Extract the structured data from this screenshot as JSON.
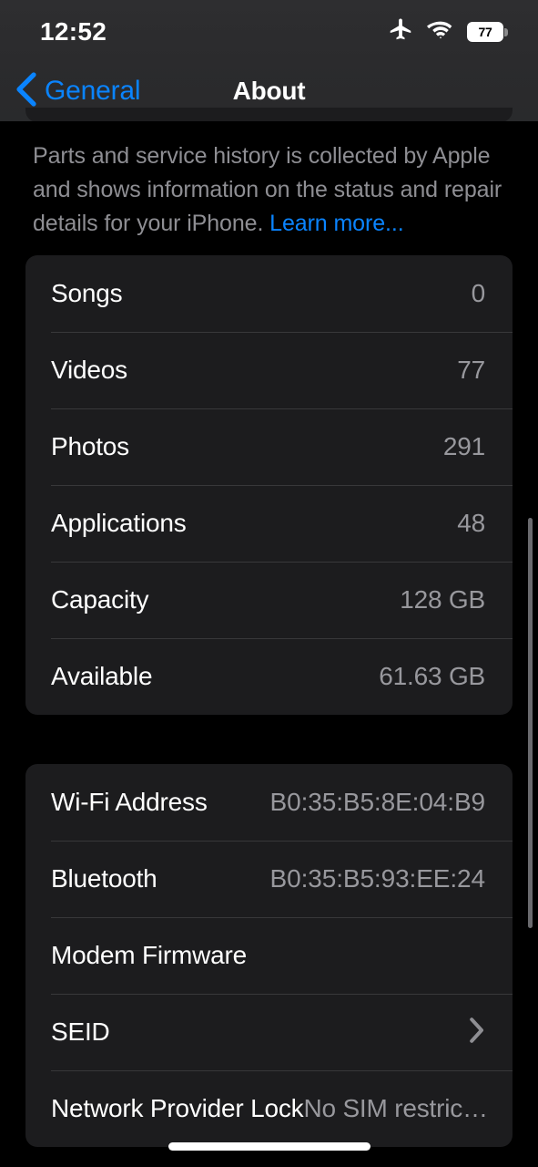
{
  "status_bar": {
    "time": "12:52",
    "battery_percent": "77",
    "icons": [
      "airplane-mode-icon",
      "wifi-icon",
      "battery-icon"
    ]
  },
  "nav": {
    "back_label": "General",
    "title": "About"
  },
  "footer_note": {
    "text": "Parts and service history is collected by Apple and shows information on the status and repair details for your iPhone. ",
    "link_label": "Learn more..."
  },
  "groups": [
    {
      "id": "storage",
      "rows": [
        {
          "label": "Songs",
          "value": "0",
          "chevron": false
        },
        {
          "label": "Videos",
          "value": "77",
          "chevron": false
        },
        {
          "label": "Photos",
          "value": "291",
          "chevron": false
        },
        {
          "label": "Applications",
          "value": "48",
          "chevron": false
        },
        {
          "label": "Capacity",
          "value": "128 GB",
          "chevron": false
        },
        {
          "label": "Available",
          "value": "61.63 GB",
          "chevron": false
        }
      ]
    },
    {
      "id": "hardware",
      "rows": [
        {
          "label": "Wi-Fi Address",
          "value": "B0:35:B5:8E:04:B9",
          "chevron": false
        },
        {
          "label": "Bluetooth",
          "value": "B0:35:B5:93:EE:24",
          "chevron": false
        },
        {
          "label": "Modem Firmware",
          "value": "",
          "chevron": false
        },
        {
          "label": "SEID",
          "value": "",
          "chevron": true
        },
        {
          "label": "Network Provider Lock",
          "value": "No SIM restric…",
          "chevron": false
        }
      ]
    }
  ],
  "colors": {
    "accent_blue": "#0a84ff",
    "card_background": "#1c1c1e",
    "page_background": "#000000",
    "separator": "#38383a",
    "value_gray": "#98989d",
    "note_gray": "#8e8e93"
  }
}
